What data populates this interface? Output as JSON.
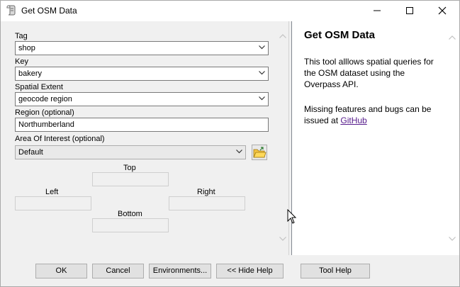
{
  "window": {
    "title": "Get OSM Data",
    "icons": {
      "app": "scroll-tool-icon",
      "minimize": "minimize-icon",
      "maximize": "maximize-icon",
      "close": "close-icon"
    }
  },
  "params": {
    "tag": {
      "label": "Tag",
      "value": "shop"
    },
    "key": {
      "label": "Key",
      "value": "bakery"
    },
    "extent": {
      "label": "Spatial Extent",
      "value": "geocode region"
    },
    "region": {
      "label": "Region (optional)",
      "value": "Northumberland"
    },
    "aoi": {
      "label": "Area Of Interest (optional)",
      "value": "Default",
      "top_label": "Top",
      "left_label": "Left",
      "right_label": "Right",
      "bottom_label": "Bottom"
    }
  },
  "help": {
    "title": "Get OSM Data",
    "paragraph1": "This tool alllows spatial queries for the OSM dataset using the Overpass API.",
    "paragraph2_prefix": "Missing features and bugs can be issued at ",
    "link_text": "GitHub"
  },
  "buttons": {
    "ok": "OK",
    "cancel": "Cancel",
    "environments": "Environments...",
    "hide_help": "<< Hide Help",
    "tool_help": "Tool Help"
  },
  "colors": {
    "link": "#551a8b",
    "pane_bg": "#f0f0f0",
    "help_bg": "#ffffff"
  }
}
